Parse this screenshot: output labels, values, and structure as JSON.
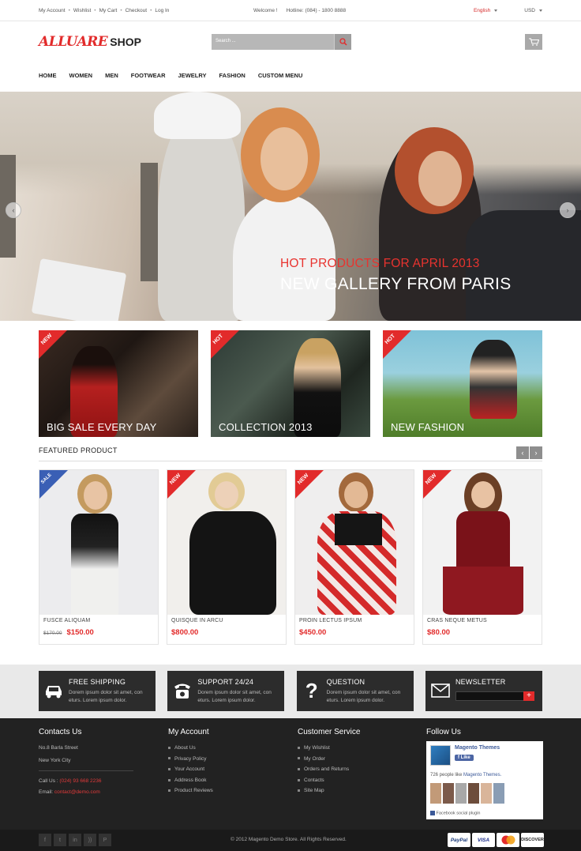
{
  "topbar": {
    "links": [
      "My Account",
      "Wishlist",
      "My Cart",
      "Checkout",
      "Log In"
    ],
    "welcome": "Welcome !",
    "hotline": "Hotline: (084) - 1800 8888",
    "language": "English",
    "currency": "USD"
  },
  "header": {
    "logo_main": "ALLUARE",
    "logo_sub": "SHOP",
    "search_placeholder": "Search ...",
    "icons": {
      "search": "search-icon",
      "cart": "cart-icon"
    }
  },
  "nav": [
    "HOME",
    "WOMEN",
    "MEN",
    "FOOTWEAR",
    "JEWELRY",
    "FASHION",
    "CUSTOM MENU"
  ],
  "hero": {
    "line1": "HOT PRODUCTS FOR APRIL 2013",
    "line2": "NEW GALLERY FROM PARIS"
  },
  "banners": [
    {
      "ribbon": "NEW",
      "caption": "BIG SALE EVERY DAY"
    },
    {
      "ribbon": "HOT",
      "caption": "COLLECTION 2013"
    },
    {
      "ribbon": "HOT",
      "caption": "NEW FASHION"
    }
  ],
  "featured": {
    "title": "FEATURED PRODUCT",
    "products": [
      {
        "ribbon": "SALE",
        "name": "FUSCE ALIQUAM",
        "old_price": "$170.00",
        "price": "$150.00"
      },
      {
        "ribbon": "NEW",
        "name": "QUISQUE IN ARCU",
        "old_price": "",
        "price": "$800.00"
      },
      {
        "ribbon": "NEW",
        "name": "PROIN LECTUS IPSUM",
        "old_price": "",
        "price": "$450.00"
      },
      {
        "ribbon": "NEW",
        "name": "CRAS NEQUE METUS",
        "old_price": "",
        "price": "$80.00"
      }
    ]
  },
  "services": [
    {
      "title": "FREE SHIPPING",
      "desc": "Dorem ipsum dolor sit amet, con eturs. Lorem ipsum dolor.",
      "icon": "car-icon"
    },
    {
      "title": "SUPPORT 24/24",
      "desc": "Dorem ipsum dolor sit amet, con eturs. Lorem ipsum dolor.",
      "icon": "phone-icon"
    },
    {
      "title": "QUESTION",
      "desc": "Dorem ipsum dolor sit amet, con eturs. Lorem ipsum dolor.",
      "icon": "question-icon"
    },
    {
      "title": "NEWSLETTER",
      "desc": "",
      "icon": "envelope-icon"
    }
  ],
  "footer": {
    "contacts": {
      "title": "Contacts Us",
      "address1": "No.8 Barla Street",
      "address2": "New York City",
      "call_label": "Call Us :",
      "phone": "(024) 93 668 2236",
      "email_label": "Email:",
      "email": "contact@demo.com"
    },
    "account": {
      "title": "My Account",
      "links": [
        "About Us",
        "Privacy Policy",
        "Your Account",
        "Address Book",
        "Product Reviews"
      ]
    },
    "service": {
      "title": "Customer Service",
      "links": [
        "My Wishlist",
        "My Order",
        "Orders and Returns",
        "Contacts",
        "Site Map"
      ]
    },
    "follow": {
      "title": "Follow Us",
      "page_name": "Magento Themes",
      "like": "Like",
      "likes_text": "726 people like",
      "likes_link": "Magento Themes.",
      "plugin": "Facebook social plugin"
    }
  },
  "bottom": {
    "copyright": "© 2012 Magento Demo Store. All Rights Reserved.",
    "social_icons": [
      "facebook-icon",
      "twitter-icon",
      "linkedin-icon",
      "rss-icon",
      "pinterest-icon"
    ],
    "payments": [
      "PayPal",
      "VISA",
      "MC",
      "DISCOVER"
    ]
  },
  "colors": {
    "accent": "#e22b2b",
    "dark": "#2c2c2c",
    "footer": "#222222"
  }
}
